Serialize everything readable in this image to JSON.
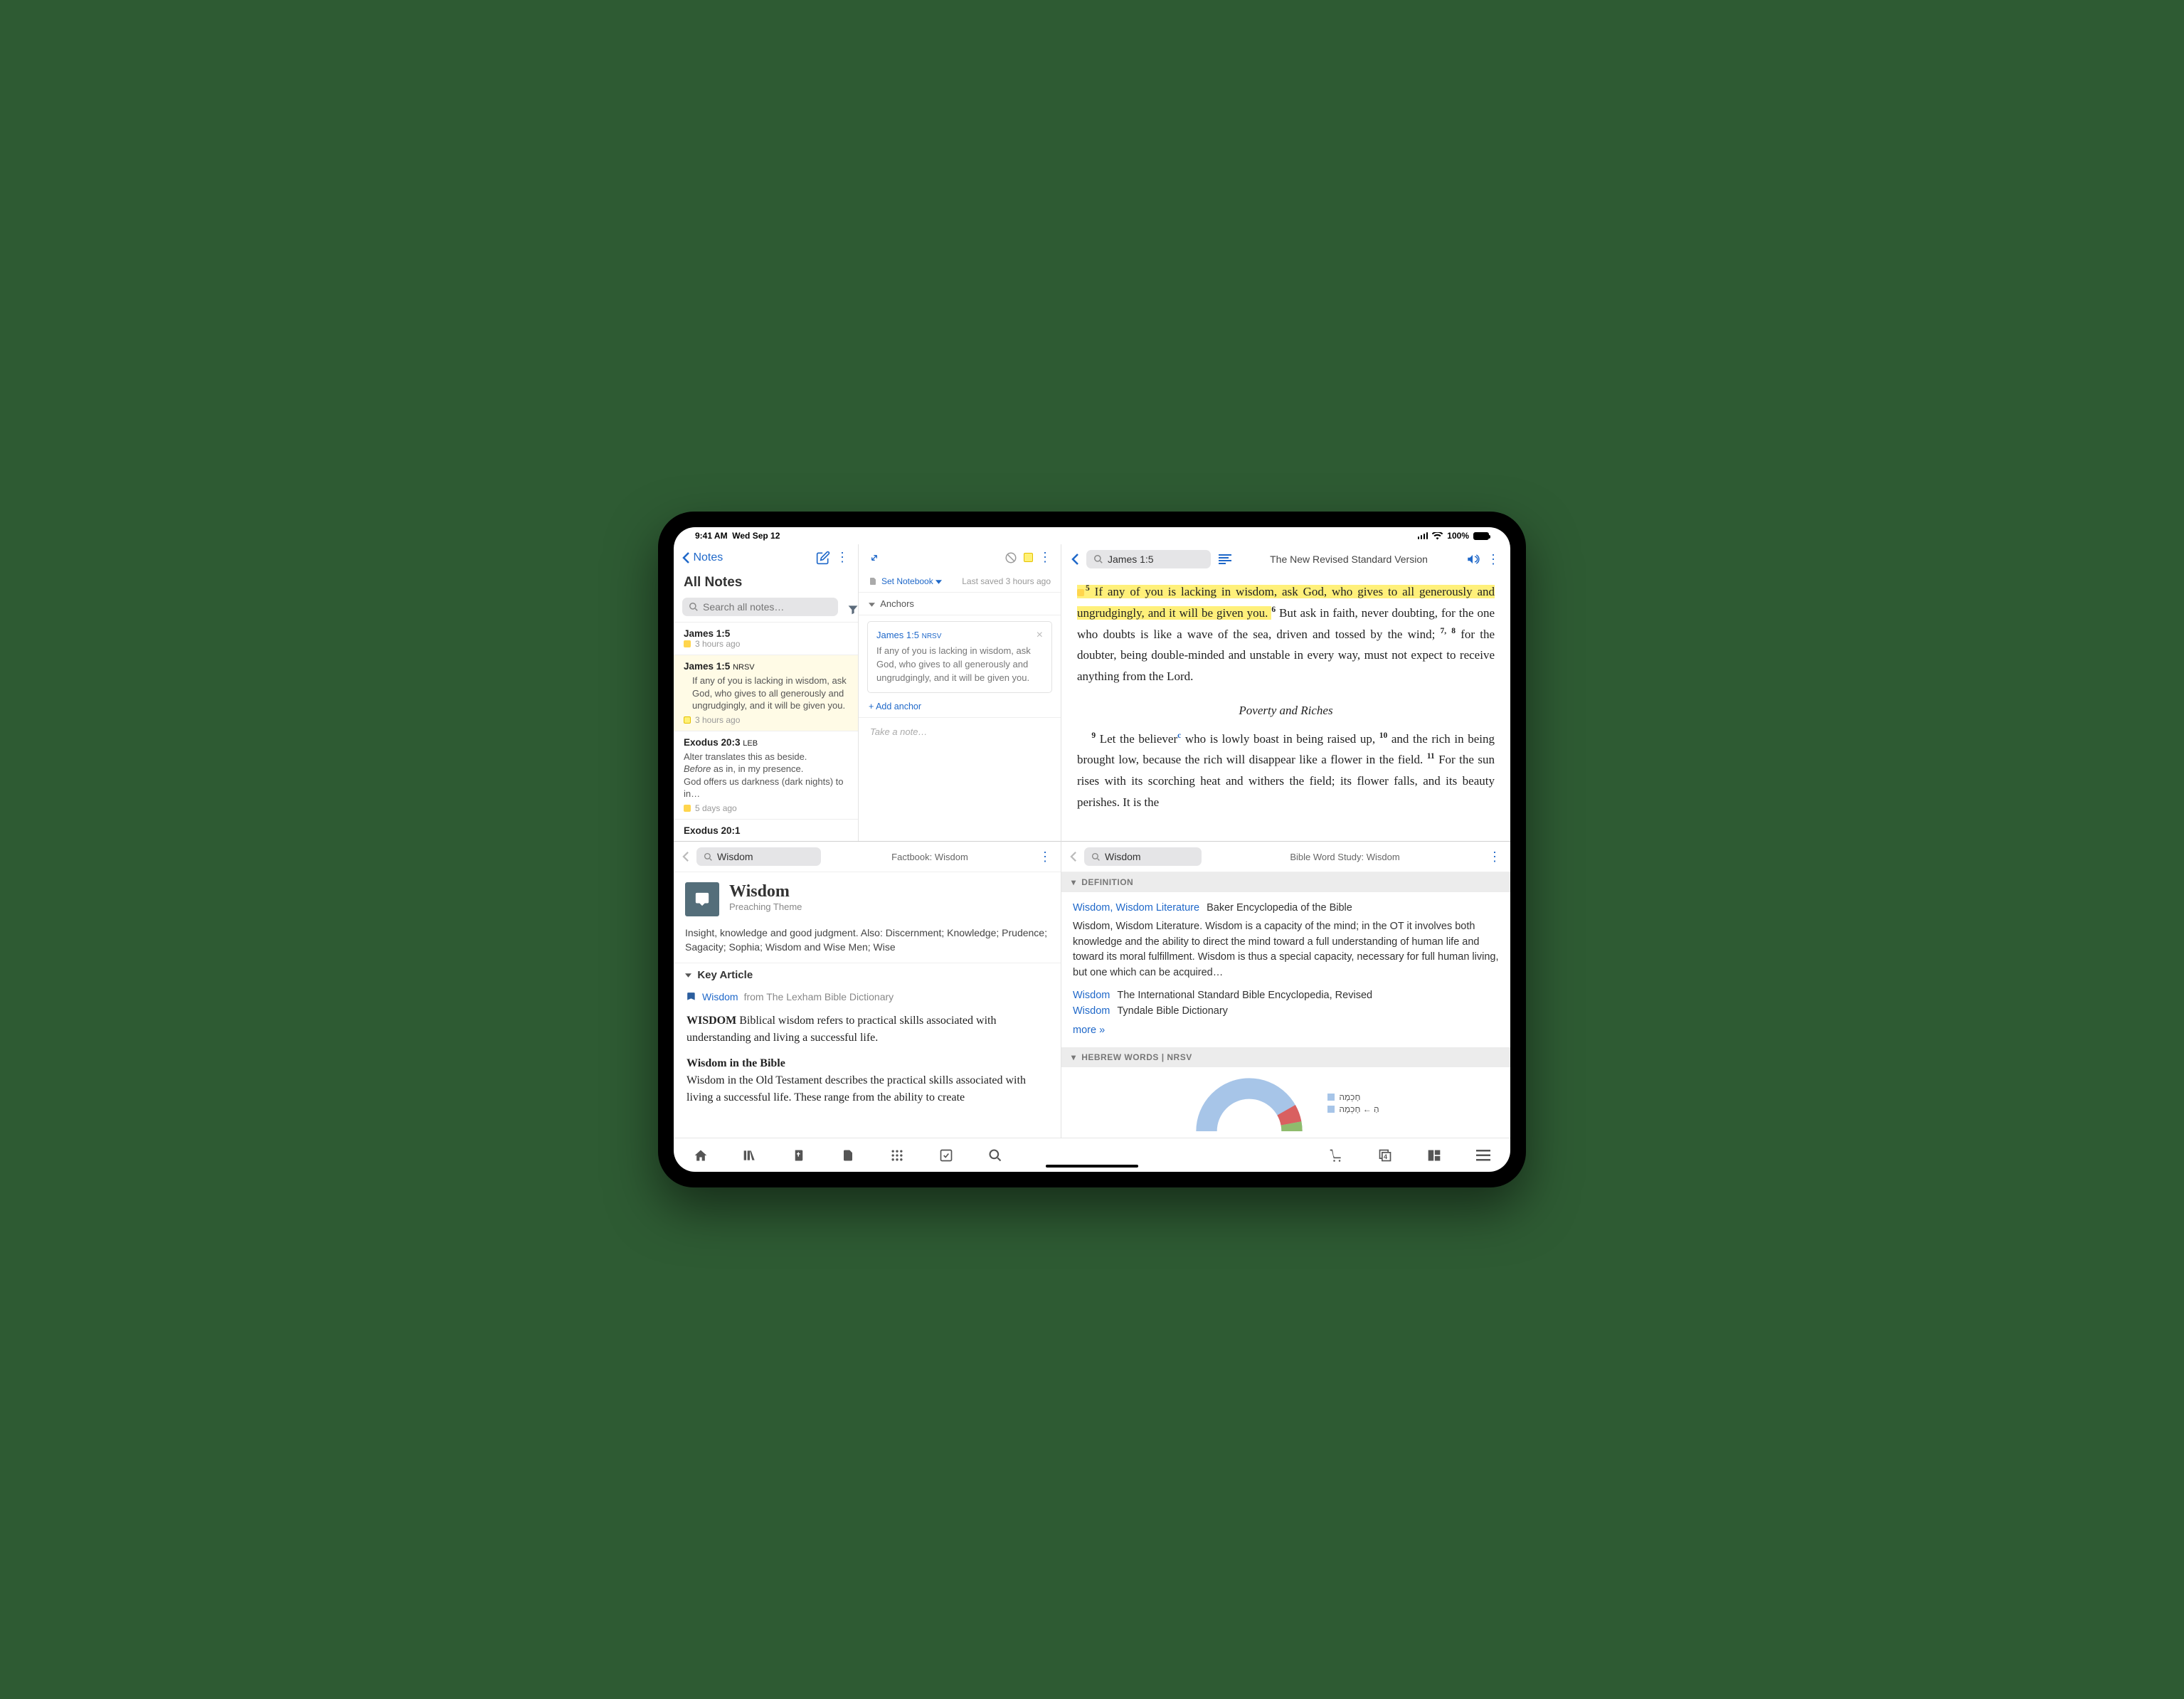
{
  "status": {
    "time": "9:41 AM",
    "date": "Wed Sep 12",
    "battery": "100%"
  },
  "notes": {
    "back": "Notes",
    "title": "All Notes",
    "search_ph": "Search all notes…",
    "items": [
      {
        "ref": "James 1:5",
        "refSmall": "",
        "body": "",
        "time": "3 hours ago",
        "icon": "sq-yellow"
      },
      {
        "ref": "James 1:5 ",
        "refSmall": "NRSV",
        "body": "If any of you is lacking in wisdom, ask God, who gives to all generously and ungrudgingly, and it will be given you.",
        "time": "3 hours ago",
        "icon": "sq-hi"
      },
      {
        "ref": "Exodus 20:3 ",
        "refSmall": "LEB",
        "body": "Alter translates this as beside.\nBefore as in, in my presence.\nGod offers us darkness (dark nights) to in…",
        "time": "5 days ago",
        "icon": "sq-yellow"
      },
      {
        "ref": "Exodus 20:1",
        "refSmall": "",
        "body": "",
        "time": "",
        "icon": ""
      }
    ]
  },
  "editor": {
    "set_notebook": "Set Notebook",
    "last_saved": "Last saved 3 hours ago",
    "anchors_label": "Anchors",
    "anchor_ref": "James 1:5 ",
    "anchor_ref_small": "NRSV",
    "anchor_text": "If any of you is lacking in wisdom, ask God, who gives to all generously and ungrudgingly, and it will be given you.",
    "add_anchor": "+ Add anchor",
    "take_note": "Take a note…"
  },
  "bible": {
    "search": "James 1:5",
    "version": "The New Revised Standard Version",
    "v5a": "If any of you is lacking in wisdom, ask God, who gives to all gener­ously and ungrudgingly, and it will be given you. ",
    "v6": "But ask in faith, never doubting, for the one who doubts is like a wave of the sea, driven and tossed by the wind; ",
    "v8a": " for the doubter, being double-minded and unstable in every way, must not expect to receive any­thing from the Lord.",
    "section": "Poverty and Riches",
    "v9a": "Let the believer",
    "v9b": " who is lowly boast in being raised up, ",
    "v10": "and the rich in being brought low, because the rich will disappear like a flower in the field. ",
    "v11": "For the sun rises with its scorching heat and withers the field; its flower falls, and its beauty perishes. It is the"
  },
  "factbook": {
    "search": "Wisdom",
    "title_bar": "Factbook: Wisdom",
    "title": "Wisdom",
    "subtitle": "Preaching Theme",
    "desc": "Insight, knowledge and good judgment. Also: Discernment; Knowledge; Prudence; Sagacity; Sophia; Wisdom and Wise Men; Wise",
    "key_section": "Key Article",
    "key_link": "Wisdom",
    "key_from": "from The Lexham Bible Dictionary",
    "body_head": "WISDOM",
    "body_text": " Biblical wisdom refers to practical skills associated with understanding and living a successful life.",
    "wib_title": "Wisdom in the Bible",
    "wib_text": "Wisdom in the Old Testament describes the practical skills associated with living a successful life. These range from the ability to create"
  },
  "bws": {
    "search": "Wisdom",
    "title_bar": "Bible Word Study: Wisdom",
    "sect_def": "DEFINITION",
    "def1_link": "Wisdom, Wisdom Literature",
    "def1_src": "Baker Encyclopedia of the Bible",
    "def1_body": "Wisdom, Wisdom Literature. Wisdom is a capacity of the mind; in the OT it involves both knowledge and the ability to direct the mind toward a full understanding of human life and toward its moral fulfillment. Wisdom is thus a special capacity, necessary for full human living, but one which can be acquired…",
    "def2_link": "Wisdom",
    "def2_src": "The International Standard Bible Encyclopedia, Revised",
    "def3_link": "Wisdom",
    "def3_src": "Tyndale Bible Dictionary",
    "more": "more »",
    "sect_heb": "HEBREW WORDS | NRSV",
    "legend1": "חָכְמָה",
    "legend2": "הַ ← חָכְמָה"
  }
}
